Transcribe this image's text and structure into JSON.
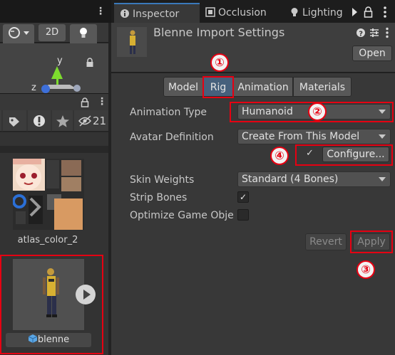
{
  "left_panel": {
    "toolbar": {
      "mode_2d": "2D"
    },
    "gizmo": {
      "y_label": "y",
      "z_label": "z"
    },
    "project": {
      "hidden_count": "21"
    },
    "assets": [
      {
        "name": "atlas_color_2"
      },
      {
        "name": "blenne"
      }
    ]
  },
  "inspector": {
    "tabs": [
      {
        "label": "Inspector"
      },
      {
        "label": "Occlusion"
      },
      {
        "label": "Lighting"
      }
    ],
    "header": {
      "title": "Blenne Import Settings",
      "open_label": "Open"
    },
    "rig_tabs": [
      {
        "label": "Model"
      },
      {
        "label": "Rig"
      },
      {
        "label": "Animation"
      },
      {
        "label": "Materials"
      }
    ],
    "fields": {
      "animation_type": {
        "label": "Animation Type",
        "value": "Humanoid"
      },
      "avatar_definition": {
        "label": "Avatar Definition",
        "value": "Create From This Model"
      },
      "configure": {
        "check": "✓",
        "button_label": "Configure..."
      },
      "skin_weights": {
        "label": "Skin Weights",
        "value": "Standard (4 Bones)"
      },
      "strip_bones": {
        "label": "Strip Bones",
        "check": "✓"
      },
      "optimize": {
        "label": "Optimize Game Obje"
      }
    },
    "buttons": {
      "revert": "Revert",
      "apply": "Apply"
    }
  },
  "annotations": {
    "markers": [
      "①",
      "②",
      "③",
      "④"
    ],
    "color": "#e60012"
  }
}
